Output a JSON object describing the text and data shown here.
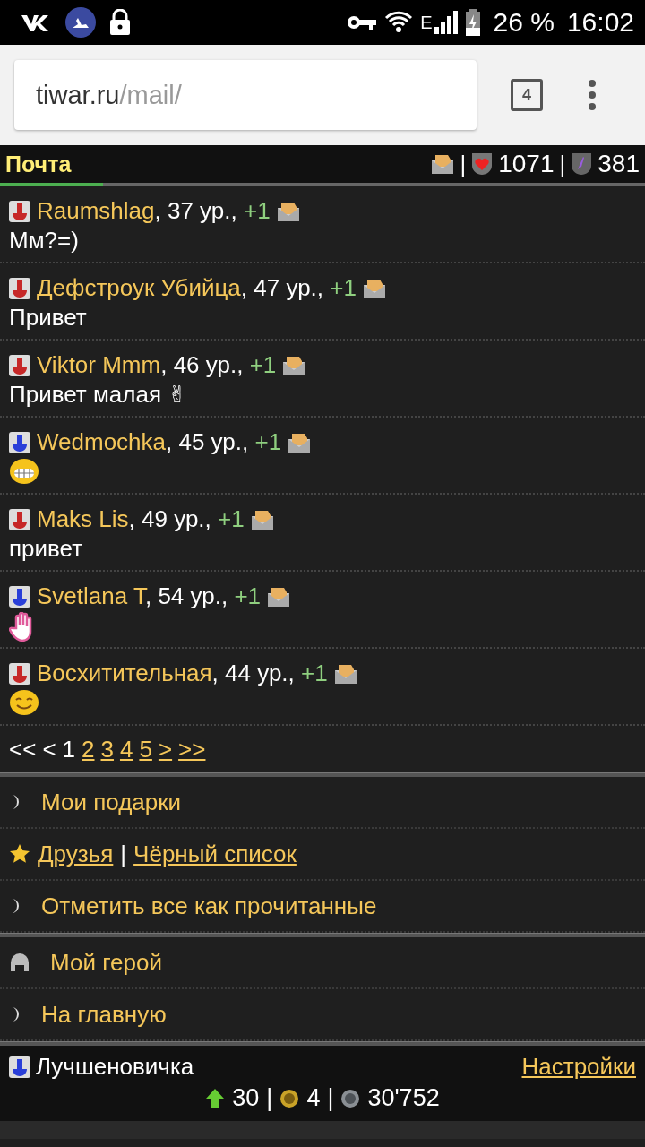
{
  "status_bar": {
    "network": "E",
    "battery": "26 %",
    "time": "16:02"
  },
  "browser": {
    "url_host": "tiwar.ru",
    "url_path": "/mail/",
    "tab_count": "4"
  },
  "header": {
    "title": "Почта",
    "separators": [
      "|",
      "|"
    ],
    "health": "1071",
    "energy": "381",
    "level": 0.16
  },
  "messages": [
    {
      "name": "Raumshlag",
      "color": "#c62828",
      "meta": ", 37 ур., ",
      "bonus": "+1",
      "kind": "text",
      "text": "Мм?=)"
    },
    {
      "name": "Дефстроук Убийца",
      "color": "#c62828",
      "meta": ", 47 ур., ",
      "bonus": "+1",
      "kind": "text",
      "text": "Привет"
    },
    {
      "name": "Viktor Mmm",
      "color": "#c62828",
      "meta": ", 46 ур., ",
      "bonus": "+1",
      "kind": "text",
      "text": "Привет малая ✌"
    },
    {
      "name": "Wedmochka",
      "color": "#2a3fd8",
      "meta": ", 45 ур., ",
      "bonus": "+1",
      "kind": "grin"
    },
    {
      "name": "Maks Lis",
      "color": "#c62828",
      "meta": ", 49 ур., ",
      "bonus": "+1",
      "kind": "text",
      "text": "привет"
    },
    {
      "name": "Svetlana T",
      "color": "#2a3fd8",
      "meta": ", 54 ур., ",
      "bonus": "+1",
      "kind": "hand"
    },
    {
      "name": "Восхитительная",
      "color": "#c62828",
      "meta": ", 44 ур., ",
      "bonus": "+1",
      "kind": "smile"
    }
  ],
  "pagination": [
    {
      "label": "<<",
      "link": false
    },
    {
      "label": "<",
      "link": false
    },
    {
      "label": "1",
      "link": false
    },
    {
      "label": "2",
      "link": true
    },
    {
      "label": "3",
      "link": true
    },
    {
      "label": "4",
      "link": true
    },
    {
      "label": "5",
      "link": true
    },
    {
      "label": ">",
      "link": true
    },
    {
      "label": ">>",
      "link": true
    }
  ],
  "menu1": [
    {
      "kind": "bullet",
      "label": "Мои подарки"
    },
    {
      "kind": "links",
      "links": [
        "Друзья",
        "Чёрный список"
      ],
      "separator": "|"
    },
    {
      "kind": "bullet",
      "label": "Отметить все как прочитанные"
    }
  ],
  "menu2": [
    {
      "kind": "hero",
      "label": "Мой герой"
    },
    {
      "kind": "bullet",
      "label": "На главную"
    }
  ],
  "footer": {
    "player": "Лучшеновичка",
    "color": "#2a3fd8",
    "settings": "Настройки",
    "level": "30",
    "separators": [
      "|",
      "|"
    ],
    "gold": "4",
    "silver": "30'752"
  }
}
